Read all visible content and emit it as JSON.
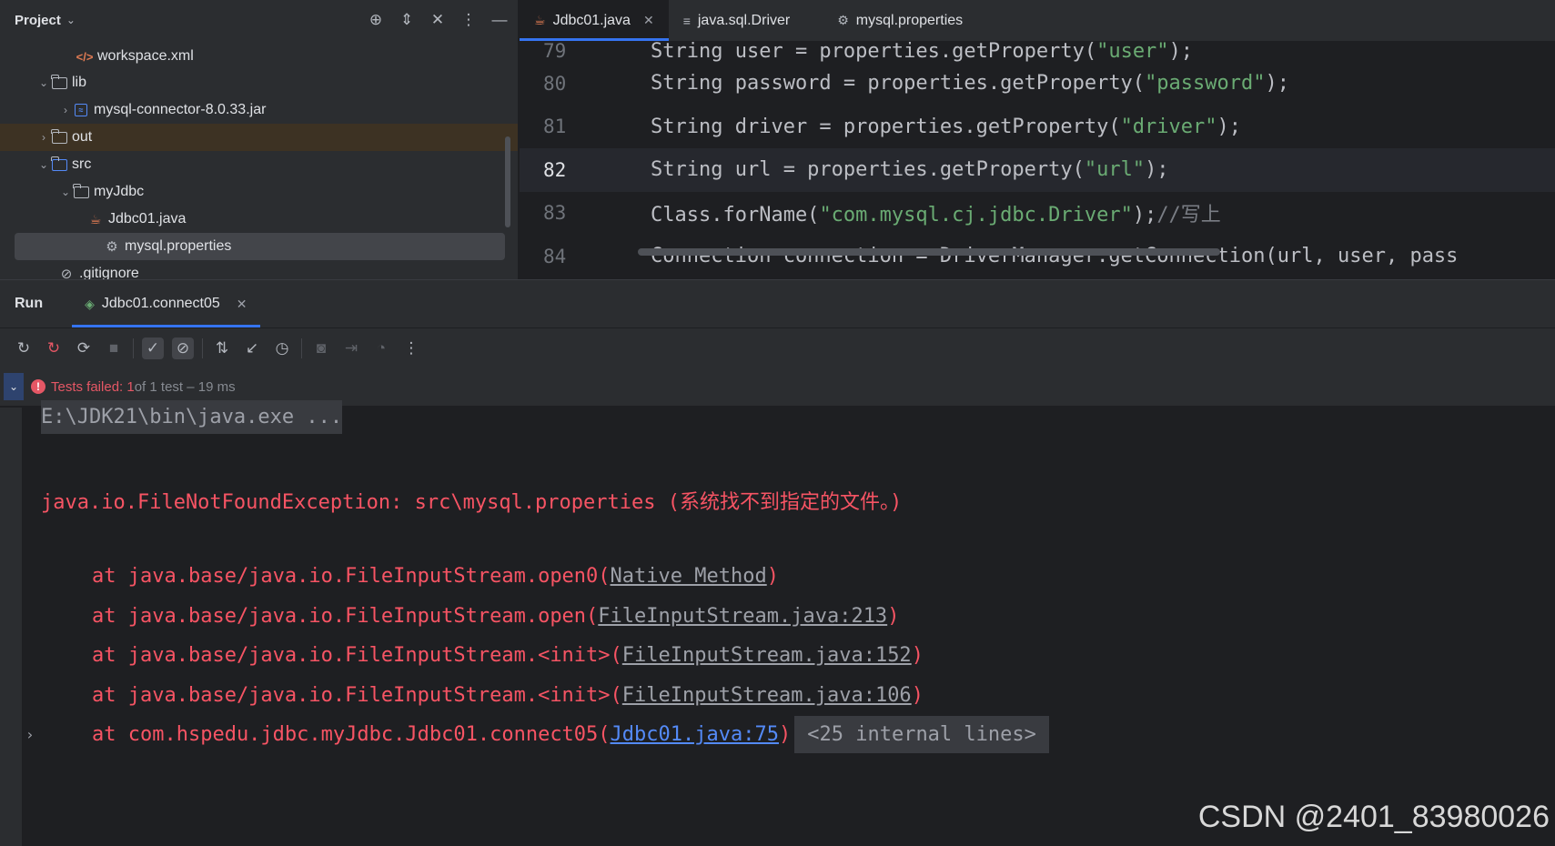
{
  "project": {
    "title": "Project",
    "tree": [
      {
        "label": "workspace.xml",
        "icon": "xml-file-icon",
        "indent": 1,
        "arrow": ""
      },
      {
        "label": "lib",
        "icon": "folder-icon",
        "indent": 0,
        "arrow": "v"
      },
      {
        "label": "mysql-connector-8.0.33.jar",
        "icon": "jar-icon",
        "indent": 1,
        "arrow": ">"
      },
      {
        "label": "out",
        "icon": "folder-icon",
        "indent": 0,
        "arrow": ">"
      },
      {
        "label": "src",
        "icon": "folder-icon",
        "indent": 0,
        "arrow": "v"
      },
      {
        "label": "myJdbc",
        "icon": "package-folder-icon",
        "indent": 1,
        "arrow": "v"
      },
      {
        "label": "Jdbc01.java",
        "icon": "java-file-icon",
        "indent": 2,
        "arrow": ""
      },
      {
        "label": "mysql.properties",
        "icon": "properties-gear-icon",
        "indent": 2,
        "arrow": ""
      },
      {
        "label": ".gitignore",
        "icon": "ignore-file-icon",
        "indent": 0,
        "arrow": ""
      }
    ]
  },
  "editor": {
    "tabs": [
      {
        "label": "Jdbc01.java",
        "icon": "java-file-icon",
        "active": true,
        "closable": true
      },
      {
        "label": "java.sql.Driver",
        "icon": "text-file-icon",
        "active": false,
        "closable": false
      },
      {
        "label": "mysql.properties",
        "icon": "properties-gear-icon",
        "active": false,
        "closable": false
      }
    ],
    "lines": [
      {
        "num": "79",
        "pre": "String user = properties.getProperty(",
        "str": "\"user\"",
        "post": ");",
        "cmt": ""
      },
      {
        "num": "80",
        "pre": "String password = properties.getProperty(",
        "str": "\"password\"",
        "post": ");",
        "cmt": ""
      },
      {
        "num": "81",
        "pre": "String driver = properties.getProperty(",
        "str": "\"driver\"",
        "post": ");",
        "cmt": ""
      },
      {
        "num": "82",
        "pre": "String url = properties.getProperty(",
        "str": "\"url\"",
        "post": ");",
        "cmt": ""
      },
      {
        "num": "83",
        "pre": "Class.forName(",
        "str": "\"com.mysql.cj.jdbc.Driver\"",
        "post": ");",
        "cmt": "//写上"
      },
      {
        "num": "84",
        "pre": "Connection connection = DriverManager.getConnection(url, user, pass",
        "str": "",
        "post": "",
        "cmt": ""
      }
    ],
    "current_line": "82"
  },
  "run": {
    "label": "Run",
    "tab_label": "Jdbc01.connect05",
    "status": {
      "failed_label": "Tests failed: 1",
      "rest": " of 1 test – 19 ms"
    },
    "console": {
      "command": "E:\\JDK21\\bin\\java.exe ...",
      "exception": "java.io.FileNotFoundException: src\\mysql.properties (系统找不到指定的文件。)",
      "frames": [
        {
          "text": "at java.base/java.io.FileInputStream.open0(",
          "link": "Native Method",
          "end": ")",
          "link_color": "gray"
        },
        {
          "text": "at java.base/java.io.FileInputStream.open(",
          "link": "FileInputStream.java:213",
          "end": ")",
          "link_color": "gray"
        },
        {
          "text": "at java.base/java.io.FileInputStream.<init>(",
          "link": "FileInputStream.java:152",
          "end": ")",
          "link_color": "gray"
        },
        {
          "text": "at java.base/java.io.FileInputStream.<init>(",
          "link": "FileInputStream.java:106",
          "end": ")",
          "link_color": "gray"
        },
        {
          "text": "at com.hspedu.jdbc.myJdbc.Jdbc01.connect05(",
          "link": "Jdbc01.java:75",
          "end": ")",
          "link_color": "blue"
        }
      ],
      "internal_lines": "<25 internal lines>"
    }
  },
  "watermark": "CSDN @2401_83980026"
}
